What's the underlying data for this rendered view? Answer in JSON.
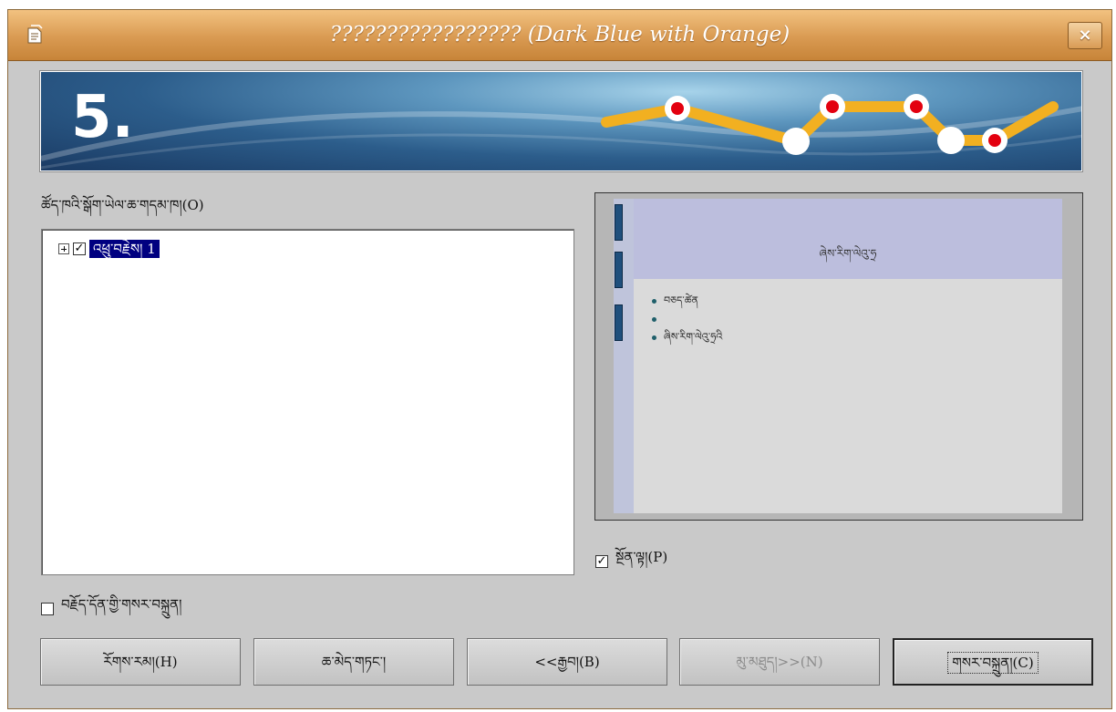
{
  "window": {
    "title": "????????????????? (Dark Blue with Orange)",
    "close_label": "×"
  },
  "banner": {
    "step_number": "5."
  },
  "outline": {
    "label": "ཚོད་ཁའི་སྒོག་ཡེལ་ཆ་གདམ་ཁ།(O)",
    "items": [
      {
        "label": "འཕྲུ་བརྗེས། 1",
        "checked": true
      }
    ]
  },
  "preview_slide": {
    "title": "ཞེས་རིག་ལེའུ་ཧྲ",
    "bullets": [
      "བཅད་ཚེན",
      "",
      "ཞིས་རིག་ལེའུ་ཧྲའི"
    ]
  },
  "options": {
    "preview_label": "སྔོན་ལྟ།(P)",
    "preview_checked": true,
    "notes_label": "བརྗོད་དོན་གྱི་གསར་བསྐྲུན།",
    "notes_checked": false
  },
  "buttons": {
    "help": "རོགས་རམ།(H)",
    "cancel": "ཆ་མེད་གཏང་།",
    "back": "<<རྒྱབ།(B)",
    "next": "མུ་མཐུད།>>(N)",
    "create": "གསར་བསྐྲུན།(C)"
  },
  "colors": {
    "titlebar": "#d99a52",
    "banner": "#2c5d8b",
    "accent_line": "#f2b021",
    "marker": "#e3000f"
  }
}
